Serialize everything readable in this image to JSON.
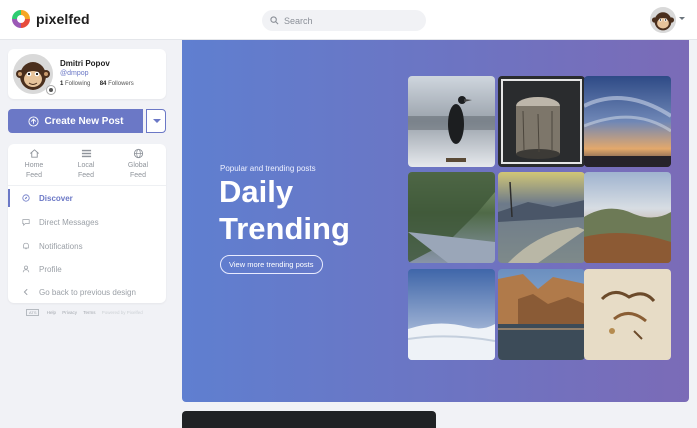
{
  "app": {
    "name": "pixelfed",
    "colors": {
      "accent": "#6b78c6",
      "hero_start": "#5f7fd0",
      "hero_end": "#7b6bb7"
    }
  },
  "navbar": {
    "search_placeholder": "Search",
    "icons": [
      "pixelfed-logo-icon",
      "search-icon",
      "user-avatar",
      "chevron-down-icon"
    ]
  },
  "profile": {
    "name": "Dmitri Popov",
    "handle": "@dmpop",
    "following_count": "1",
    "following_label": "Following",
    "followers_count": "84",
    "followers_label": "Followers"
  },
  "create_post": {
    "label": "Create New Post"
  },
  "feeds": [
    {
      "line1": "Home",
      "line2": "Feed",
      "icon": "home-icon"
    },
    {
      "line1": "Local",
      "line2": "Feed",
      "icon": "list-icon"
    },
    {
      "line1": "Global",
      "line2": "Feed",
      "icon": "globe-icon"
    }
  ],
  "menu": [
    {
      "label": "Discover",
      "icon": "compass-icon",
      "active": true
    },
    {
      "label": "Direct Messages",
      "icon": "message-icon",
      "active": false
    },
    {
      "label": "Notifications",
      "icon": "bell-icon",
      "active": false
    },
    {
      "label": "Profile",
      "icon": "user-icon",
      "active": false
    },
    {
      "label": "Go back to previous design",
      "icon": "chevron-left-icon",
      "active": false
    }
  ],
  "footer": {
    "badge": "ATS",
    "links": [
      "Help",
      "Privacy",
      "Terms"
    ],
    "powered": "Powered by Pixelfed"
  },
  "hero": {
    "subtitle": "Popular and trending posts",
    "title": "Daily Trending",
    "button": "View more trending posts"
  }
}
